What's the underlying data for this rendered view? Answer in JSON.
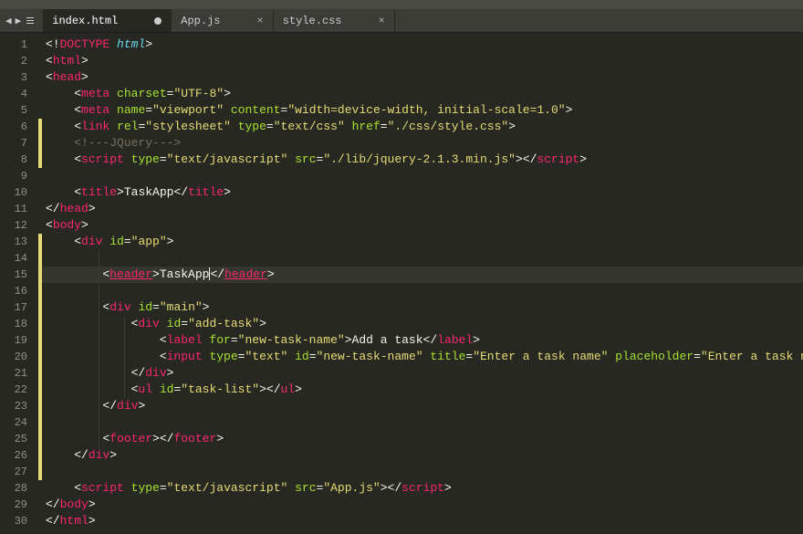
{
  "tabs": [
    {
      "label": "index.html",
      "active": true,
      "dirty": true
    },
    {
      "label": "App.js",
      "active": false,
      "dirty": false
    },
    {
      "label": "style.css",
      "active": false,
      "dirty": false
    }
  ],
  "activeLine": 15,
  "markStrips": [
    6,
    7,
    8,
    13,
    14,
    15,
    16,
    17,
    18,
    19,
    20,
    21,
    22,
    23,
    24,
    25,
    26,
    27
  ],
  "indentGuides": {
    "col1": [
      14,
      15,
      16,
      17,
      18,
      19,
      20,
      21,
      22,
      23,
      24,
      25
    ],
    "col2": [
      18,
      19,
      20,
      21,
      22
    ]
  },
  "lines": [
    [
      {
        "c": "punc",
        "t": "<!"
      },
      {
        "c": "doct",
        "t": "DOCTYPE"
      },
      {
        "c": "punc",
        "t": " "
      },
      {
        "c": "docn",
        "t": "html"
      },
      {
        "c": "punc",
        "t": ">"
      }
    ],
    [
      {
        "c": "punc",
        "t": "<"
      },
      {
        "c": "tag",
        "t": "html"
      },
      {
        "c": "punc",
        "t": ">"
      }
    ],
    [
      {
        "c": "punc",
        "t": "<"
      },
      {
        "c": "tag",
        "t": "head"
      },
      {
        "c": "punc",
        "t": ">"
      }
    ],
    [
      {
        "c": "punc",
        "t": "    <"
      },
      {
        "c": "tag",
        "t": "meta"
      },
      {
        "c": "punc",
        "t": " "
      },
      {
        "c": "attr",
        "t": "charset"
      },
      {
        "c": "punc",
        "t": "="
      },
      {
        "c": "str",
        "t": "\"UTF-8\""
      },
      {
        "c": "punc",
        "t": ">"
      }
    ],
    [
      {
        "c": "punc",
        "t": "    <"
      },
      {
        "c": "tag",
        "t": "meta"
      },
      {
        "c": "punc",
        "t": " "
      },
      {
        "c": "attr",
        "t": "name"
      },
      {
        "c": "punc",
        "t": "="
      },
      {
        "c": "str",
        "t": "\"viewport\""
      },
      {
        "c": "punc",
        "t": " "
      },
      {
        "c": "attr",
        "t": "content"
      },
      {
        "c": "punc",
        "t": "="
      },
      {
        "c": "str",
        "t": "\"width=device-width, initial-scale=1.0\""
      },
      {
        "c": "punc",
        "t": ">"
      }
    ],
    [
      {
        "c": "punc",
        "t": "    <"
      },
      {
        "c": "tag",
        "t": "link"
      },
      {
        "c": "punc",
        "t": " "
      },
      {
        "c": "attr",
        "t": "rel"
      },
      {
        "c": "punc",
        "t": "="
      },
      {
        "c": "str",
        "t": "\"stylesheet\""
      },
      {
        "c": "punc",
        "t": " "
      },
      {
        "c": "attr",
        "t": "type"
      },
      {
        "c": "punc",
        "t": "="
      },
      {
        "c": "str",
        "t": "\"text/css\""
      },
      {
        "c": "punc",
        "t": " "
      },
      {
        "c": "attr",
        "t": "href"
      },
      {
        "c": "punc",
        "t": "="
      },
      {
        "c": "str",
        "t": "\"./css/style.css\""
      },
      {
        "c": "punc",
        "t": ">"
      }
    ],
    [
      {
        "c": "cmt",
        "t": "    <!---JQuery--->"
      }
    ],
    [
      {
        "c": "punc",
        "t": "    <"
      },
      {
        "c": "tag",
        "t": "script"
      },
      {
        "c": "punc",
        "t": " "
      },
      {
        "c": "attr",
        "t": "type"
      },
      {
        "c": "punc",
        "t": "="
      },
      {
        "c": "str",
        "t": "\"text/javascript\""
      },
      {
        "c": "punc",
        "t": " "
      },
      {
        "c": "attr",
        "t": "src"
      },
      {
        "c": "punc",
        "t": "="
      },
      {
        "c": "str",
        "t": "\"./lib/jquery-2.1.3.min.js\""
      },
      {
        "c": "punc",
        "t": "></"
      },
      {
        "c": "tag",
        "t": "script"
      },
      {
        "c": "punc",
        "t": ">"
      }
    ],
    [],
    [
      {
        "c": "punc",
        "t": "    <"
      },
      {
        "c": "tag",
        "t": "title"
      },
      {
        "c": "punc",
        "t": ">"
      },
      {
        "c": "txt",
        "t": "TaskApp"
      },
      {
        "c": "punc",
        "t": "</"
      },
      {
        "c": "tag",
        "t": "title"
      },
      {
        "c": "punc",
        "t": ">"
      }
    ],
    [
      {
        "c": "punc",
        "t": "</"
      },
      {
        "c": "tag",
        "t": "head"
      },
      {
        "c": "punc",
        "t": ">"
      }
    ],
    [
      {
        "c": "punc",
        "t": "<"
      },
      {
        "c": "tag",
        "t": "body"
      },
      {
        "c": "punc",
        "t": ">"
      }
    ],
    [
      {
        "c": "punc",
        "t": "    <"
      },
      {
        "c": "tag",
        "t": "div"
      },
      {
        "c": "punc",
        "t": " "
      },
      {
        "c": "attr",
        "t": "id"
      },
      {
        "c": "punc",
        "t": "="
      },
      {
        "c": "str",
        "t": "\"app\""
      },
      {
        "c": "punc",
        "t": ">"
      }
    ],
    [],
    [
      {
        "c": "punc",
        "t": "        <"
      },
      {
        "c": "tag",
        "u": true,
        "t": "header"
      },
      {
        "c": "punc",
        "t": ">"
      },
      {
        "c": "txt",
        "t": "TaskApp"
      },
      {
        "caret": true
      },
      {
        "c": "punc",
        "t": "</"
      },
      {
        "c": "tag",
        "u": true,
        "t": "header"
      },
      {
        "c": "punc",
        "t": ">"
      }
    ],
    [],
    [
      {
        "c": "punc",
        "t": "        <"
      },
      {
        "c": "tag",
        "t": "div"
      },
      {
        "c": "punc",
        "t": " "
      },
      {
        "c": "attr",
        "t": "id"
      },
      {
        "c": "punc",
        "t": "="
      },
      {
        "c": "str",
        "t": "\"main\""
      },
      {
        "c": "punc",
        "t": ">"
      }
    ],
    [
      {
        "c": "punc",
        "t": "            <"
      },
      {
        "c": "tag",
        "t": "div"
      },
      {
        "c": "punc",
        "t": " "
      },
      {
        "c": "attr",
        "t": "id"
      },
      {
        "c": "punc",
        "t": "="
      },
      {
        "c": "str",
        "t": "\"add-task\""
      },
      {
        "c": "punc",
        "t": ">"
      }
    ],
    [
      {
        "c": "punc",
        "t": "                <"
      },
      {
        "c": "tag",
        "t": "label"
      },
      {
        "c": "punc",
        "t": " "
      },
      {
        "c": "attr",
        "t": "for"
      },
      {
        "c": "punc",
        "t": "="
      },
      {
        "c": "str",
        "t": "\"new-task-name\""
      },
      {
        "c": "punc",
        "t": ">"
      },
      {
        "c": "txt",
        "t": "Add a task"
      },
      {
        "c": "punc",
        "t": "</"
      },
      {
        "c": "tag",
        "t": "label"
      },
      {
        "c": "punc",
        "t": ">"
      }
    ],
    [
      {
        "c": "punc",
        "t": "                <"
      },
      {
        "c": "tag",
        "t": "input"
      },
      {
        "c": "punc",
        "t": " "
      },
      {
        "c": "attr",
        "t": "type"
      },
      {
        "c": "punc",
        "t": "="
      },
      {
        "c": "str",
        "t": "\"text\""
      },
      {
        "c": "punc",
        "t": " "
      },
      {
        "c": "attr",
        "t": "id"
      },
      {
        "c": "punc",
        "t": "="
      },
      {
        "c": "str",
        "t": "\"new-task-name\""
      },
      {
        "c": "punc",
        "t": " "
      },
      {
        "c": "attr",
        "t": "title"
      },
      {
        "c": "punc",
        "t": "="
      },
      {
        "c": "str",
        "t": "\"Enter a task name\""
      },
      {
        "c": "punc",
        "t": " "
      },
      {
        "c": "attr",
        "t": "placeholder"
      },
      {
        "c": "punc",
        "t": "="
      },
      {
        "c": "str",
        "t": "\"Enter a task name\""
      },
      {
        "c": "punc",
        "t": ">"
      }
    ],
    [
      {
        "c": "punc",
        "t": "            </"
      },
      {
        "c": "tag",
        "t": "div"
      },
      {
        "c": "punc",
        "t": ">"
      }
    ],
    [
      {
        "c": "punc",
        "t": "            <"
      },
      {
        "c": "tag",
        "t": "ul"
      },
      {
        "c": "punc",
        "t": " "
      },
      {
        "c": "attr",
        "t": "id"
      },
      {
        "c": "punc",
        "t": "="
      },
      {
        "c": "str",
        "t": "\"task-list\""
      },
      {
        "c": "punc",
        "t": "></"
      },
      {
        "c": "tag",
        "t": "ul"
      },
      {
        "c": "punc",
        "t": ">"
      }
    ],
    [
      {
        "c": "punc",
        "t": "        </"
      },
      {
        "c": "tag",
        "t": "div"
      },
      {
        "c": "punc",
        "t": ">"
      }
    ],
    [],
    [
      {
        "c": "punc",
        "t": "        <"
      },
      {
        "c": "tag",
        "t": "footer"
      },
      {
        "c": "punc",
        "t": "></"
      },
      {
        "c": "tag",
        "t": "footer"
      },
      {
        "c": "punc",
        "t": ">"
      }
    ],
    [
      {
        "c": "punc",
        "t": "    </"
      },
      {
        "c": "tag",
        "t": "div"
      },
      {
        "c": "punc",
        "t": ">"
      }
    ],
    [],
    [
      {
        "c": "punc",
        "t": "    <"
      },
      {
        "c": "tag",
        "t": "script"
      },
      {
        "c": "punc",
        "t": " "
      },
      {
        "c": "attr",
        "t": "type"
      },
      {
        "c": "punc",
        "t": "="
      },
      {
        "c": "str",
        "t": "\"text/javascript\""
      },
      {
        "c": "punc",
        "t": " "
      },
      {
        "c": "attr",
        "t": "src"
      },
      {
        "c": "punc",
        "t": "="
      },
      {
        "c": "str",
        "t": "\"App.js\""
      },
      {
        "c": "punc",
        "t": "></"
      },
      {
        "c": "tag",
        "t": "script"
      },
      {
        "c": "punc",
        "t": ">"
      }
    ],
    [
      {
        "c": "punc",
        "t": "</"
      },
      {
        "c": "tag",
        "t": "body"
      },
      {
        "c": "punc",
        "t": ">"
      }
    ],
    [
      {
        "c": "punc",
        "t": "</"
      },
      {
        "c": "tag",
        "t": "html"
      },
      {
        "c": "punc",
        "t": ">"
      }
    ]
  ]
}
